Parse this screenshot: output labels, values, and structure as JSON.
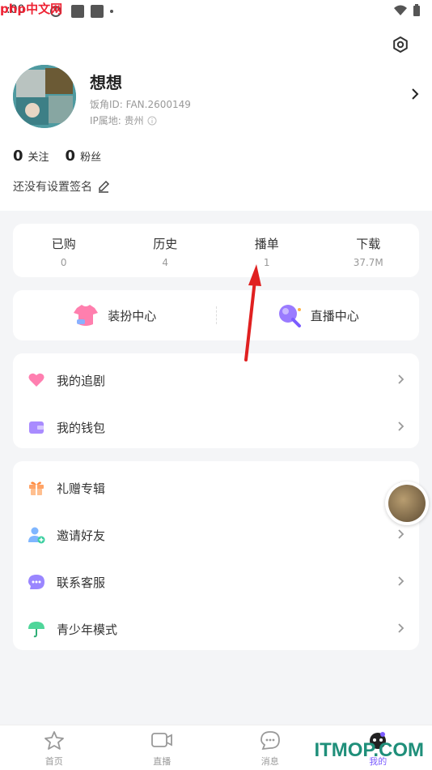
{
  "status_bar": {
    "time": ":00"
  },
  "profile": {
    "nickname": "想想",
    "uid": "饭角ID: FAN.2600149",
    "ip": "IP属地: 贵州"
  },
  "follow": {
    "following_count": "0",
    "following_label": "关注",
    "fans_count": "0",
    "fans_label": "粉丝"
  },
  "signature": "还没有设置签名",
  "stats": [
    {
      "label": "已购",
      "value": "0"
    },
    {
      "label": "历史",
      "value": "4"
    },
    {
      "label": "播单",
      "value": "1"
    },
    {
      "label": "下载",
      "value": "37.7M"
    }
  ],
  "centers": [
    {
      "label": "装扮中心",
      "icon": "tshirt-icon"
    },
    {
      "label": "直播中心",
      "icon": "microphone-icon"
    }
  ],
  "menu_group_1": [
    {
      "label": "我的追剧",
      "icon": "heart-icon",
      "color": "#ff6fa8"
    },
    {
      "label": "我的钱包",
      "icon": "wallet-icon",
      "color": "#9b7bff"
    }
  ],
  "menu_group_2": [
    {
      "label": "礼赠专辑",
      "icon": "gift-icon",
      "color": "#ff9a5a"
    },
    {
      "label": "邀请好友",
      "icon": "add-friend-icon",
      "color": "#6aa8ff"
    },
    {
      "label": "联系客服",
      "icon": "chat-bubble-icon",
      "color": "#8f7bff"
    },
    {
      "label": "青少年模式",
      "icon": "umbrella-icon",
      "color": "#3ccf8e"
    }
  ],
  "bottom_nav": [
    {
      "label": "首页",
      "icon": "home-star-icon"
    },
    {
      "label": "直播",
      "icon": "video-icon"
    },
    {
      "label": "消息",
      "icon": "message-icon"
    },
    {
      "label": "我的",
      "icon": "profile-icon"
    }
  ],
  "watermarks": {
    "top_left": "php中文网",
    "bottom_right": "ITMOP.COM"
  },
  "colors": {
    "accent": "#7b5cff",
    "arrow": "#e02020"
  }
}
